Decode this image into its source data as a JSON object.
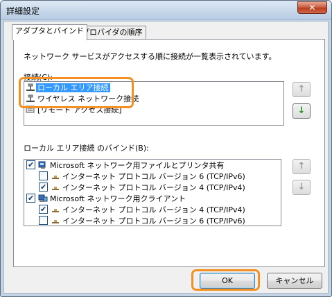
{
  "window": {
    "title": "詳細設定",
    "close_glyph": "✕"
  },
  "tabs": [
    {
      "label": "アダプタとバインド",
      "active": true
    },
    {
      "label": "プロバイダの順序",
      "active": false
    }
  ],
  "description": "ネットワーク サービスがアクセスする順に接続が一覧表示されています。",
  "connections": {
    "label": "接続(C):",
    "items": [
      {
        "label": "ローカル エリア接続",
        "selected": true,
        "icon": "network-adapter-icon"
      },
      {
        "label": "ワイヤレス ネットワーク接続",
        "selected": false,
        "icon": "network-adapter-icon"
      },
      {
        "label": "[リモート アクセス接続]",
        "selected": false,
        "icon": "remote-access-icon"
      }
    ]
  },
  "bindings": {
    "label": "ローカル エリア接続 のバインド(B):",
    "items": [
      {
        "level": 0,
        "label": "Microsoft ネットワーク用ファイルとプリンタ共有",
        "checked": true,
        "icon": "file-printer-share-icon"
      },
      {
        "level": 1,
        "label": "インターネット プロトコル バージョン 6 (TCP/IPv6)",
        "checked": false,
        "icon": "protocol-icon"
      },
      {
        "level": 1,
        "label": "インターネット プロトコル バージョン 4 (TCP/IPv4)",
        "checked": true,
        "icon": "protocol-icon"
      },
      {
        "level": 0,
        "label": "Microsoft ネットワーク用クライアント",
        "checked": true,
        "icon": "network-client-icon"
      },
      {
        "level": 1,
        "label": "インターネット プロトコル バージョン 4 (TCP/IPv4)",
        "checked": true,
        "icon": "protocol-icon"
      },
      {
        "level": 1,
        "label": "インターネット プロトコル バージョン 6 (TCP/IPv6)",
        "checked": false,
        "icon": "protocol-icon"
      }
    ]
  },
  "buttons": {
    "ok": "OK",
    "cancel": "キャンセル"
  },
  "colors": {
    "highlight": "#f39021",
    "selection": "#3399ff"
  }
}
